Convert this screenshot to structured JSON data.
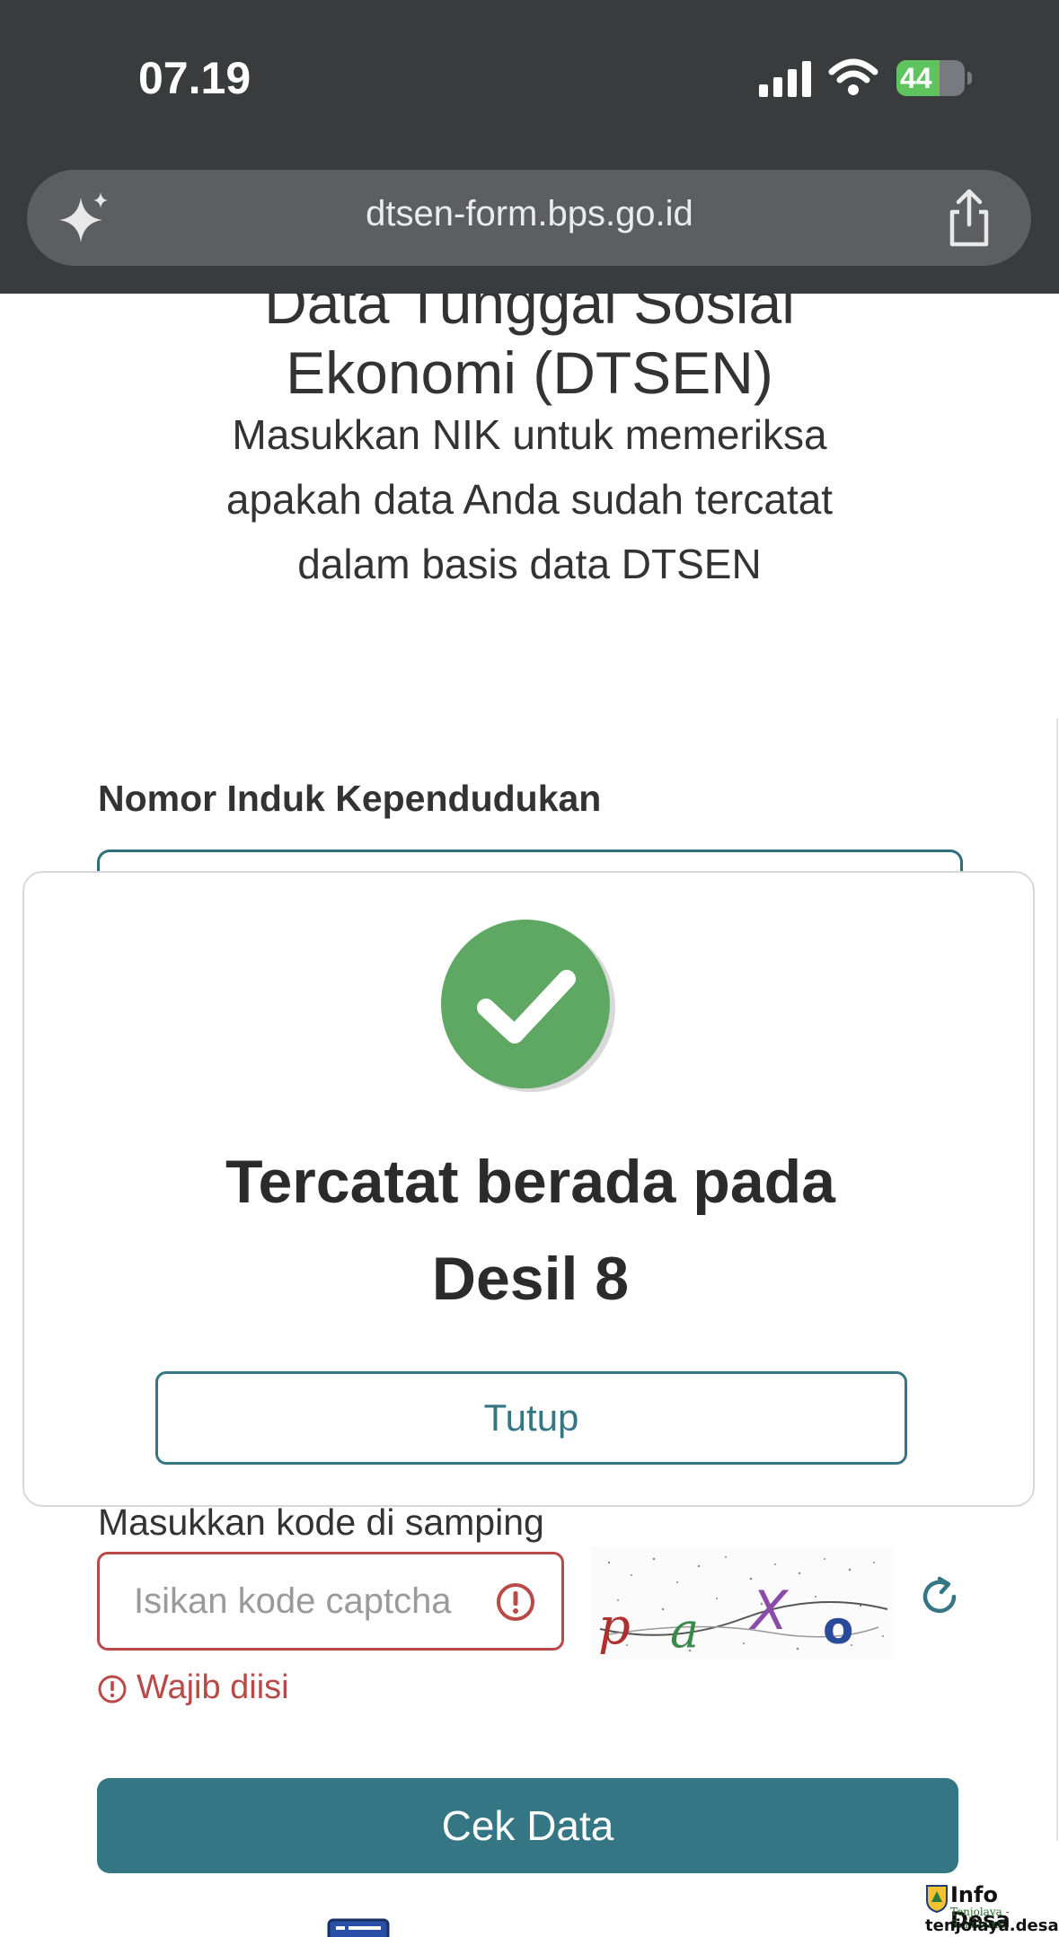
{
  "status_bar": {
    "time": "07.19",
    "battery": "44"
  },
  "browser": {
    "url": "dtsen-form.bps.go.id"
  },
  "page": {
    "title_line1": "Data Tunggal Sosial",
    "title_line2": "Ekonomi (DTSEN)",
    "subtitle_line1": "Masukkan NIK untuk memeriksa",
    "subtitle_line2": "apakah data Anda sudah tercatat",
    "subtitle_line3": "dalam basis data DTSEN",
    "nik_label": "Nomor Induk Kependudukan",
    "captcha_label": "Masukkan kode di samping",
    "captcha_placeholder": "Isikan kode captcha",
    "captcha_text": "paXo",
    "error_text": "Wajib diisi",
    "submit_label": "Cek Data"
  },
  "modal": {
    "title_line1": "Tercatat berada pada",
    "title_line2": "Desil 8",
    "close_label": "Tutup"
  },
  "watermark": {
    "title": "Info Desa",
    "subtitle": "Tenjolaya - Sukabumi",
    "url": "tenjolaya.desa.id"
  },
  "colors": {
    "primary": "#347684",
    "error": "#b94a48",
    "success": "#5fa864",
    "topbar": "#3a3b3d"
  }
}
